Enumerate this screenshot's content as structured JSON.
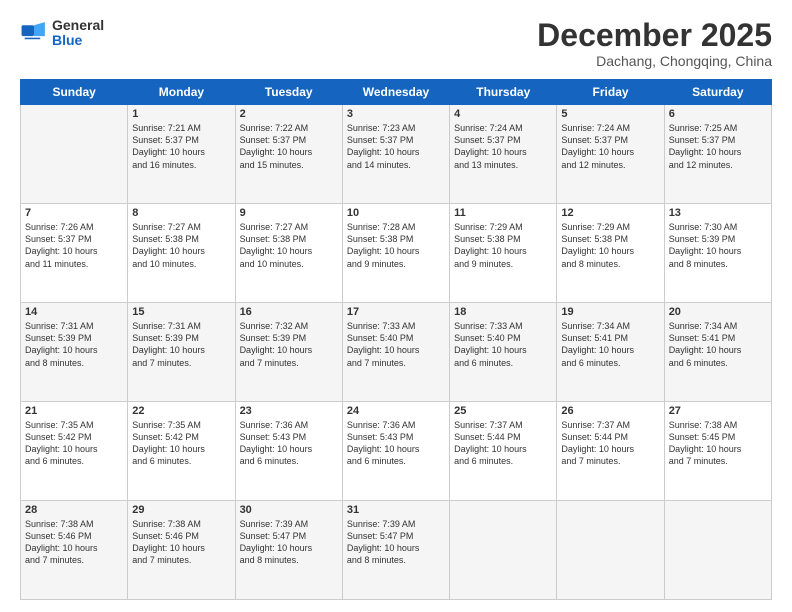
{
  "header": {
    "logo": {
      "general": "General",
      "blue": "Blue"
    },
    "title": "December 2025",
    "location": "Dachang, Chongqing, China"
  },
  "days_of_week": [
    "Sunday",
    "Monday",
    "Tuesday",
    "Wednesday",
    "Thursday",
    "Friday",
    "Saturday"
  ],
  "weeks": [
    [
      {
        "num": "",
        "info": "",
        "shade": true
      },
      {
        "num": "1",
        "info": "Sunrise: 7:21 AM\nSunset: 5:37 PM\nDaylight: 10 hours\nand 16 minutes.",
        "shade": true
      },
      {
        "num": "2",
        "info": "Sunrise: 7:22 AM\nSunset: 5:37 PM\nDaylight: 10 hours\nand 15 minutes.",
        "shade": true
      },
      {
        "num": "3",
        "info": "Sunrise: 7:23 AM\nSunset: 5:37 PM\nDaylight: 10 hours\nand 14 minutes.",
        "shade": true
      },
      {
        "num": "4",
        "info": "Sunrise: 7:24 AM\nSunset: 5:37 PM\nDaylight: 10 hours\nand 13 minutes.",
        "shade": true
      },
      {
        "num": "5",
        "info": "Sunrise: 7:24 AM\nSunset: 5:37 PM\nDaylight: 10 hours\nand 12 minutes.",
        "shade": true
      },
      {
        "num": "6",
        "info": "Sunrise: 7:25 AM\nSunset: 5:37 PM\nDaylight: 10 hours\nand 12 minutes.",
        "shade": true
      }
    ],
    [
      {
        "num": "7",
        "info": "Sunrise: 7:26 AM\nSunset: 5:37 PM\nDaylight: 10 hours\nand 11 minutes.",
        "shade": false
      },
      {
        "num": "8",
        "info": "Sunrise: 7:27 AM\nSunset: 5:38 PM\nDaylight: 10 hours\nand 10 minutes.",
        "shade": false
      },
      {
        "num": "9",
        "info": "Sunrise: 7:27 AM\nSunset: 5:38 PM\nDaylight: 10 hours\nand 10 minutes.",
        "shade": false
      },
      {
        "num": "10",
        "info": "Sunrise: 7:28 AM\nSunset: 5:38 PM\nDaylight: 10 hours\nand 9 minutes.",
        "shade": false
      },
      {
        "num": "11",
        "info": "Sunrise: 7:29 AM\nSunset: 5:38 PM\nDaylight: 10 hours\nand 9 minutes.",
        "shade": false
      },
      {
        "num": "12",
        "info": "Sunrise: 7:29 AM\nSunset: 5:38 PM\nDaylight: 10 hours\nand 8 minutes.",
        "shade": false
      },
      {
        "num": "13",
        "info": "Sunrise: 7:30 AM\nSunset: 5:39 PM\nDaylight: 10 hours\nand 8 minutes.",
        "shade": false
      }
    ],
    [
      {
        "num": "14",
        "info": "Sunrise: 7:31 AM\nSunset: 5:39 PM\nDaylight: 10 hours\nand 8 minutes.",
        "shade": true
      },
      {
        "num": "15",
        "info": "Sunrise: 7:31 AM\nSunset: 5:39 PM\nDaylight: 10 hours\nand 7 minutes.",
        "shade": true
      },
      {
        "num": "16",
        "info": "Sunrise: 7:32 AM\nSunset: 5:39 PM\nDaylight: 10 hours\nand 7 minutes.",
        "shade": true
      },
      {
        "num": "17",
        "info": "Sunrise: 7:33 AM\nSunset: 5:40 PM\nDaylight: 10 hours\nand 7 minutes.",
        "shade": true
      },
      {
        "num": "18",
        "info": "Sunrise: 7:33 AM\nSunset: 5:40 PM\nDaylight: 10 hours\nand 6 minutes.",
        "shade": true
      },
      {
        "num": "19",
        "info": "Sunrise: 7:34 AM\nSunset: 5:41 PM\nDaylight: 10 hours\nand 6 minutes.",
        "shade": true
      },
      {
        "num": "20",
        "info": "Sunrise: 7:34 AM\nSunset: 5:41 PM\nDaylight: 10 hours\nand 6 minutes.",
        "shade": true
      }
    ],
    [
      {
        "num": "21",
        "info": "Sunrise: 7:35 AM\nSunset: 5:42 PM\nDaylight: 10 hours\nand 6 minutes.",
        "shade": false
      },
      {
        "num": "22",
        "info": "Sunrise: 7:35 AM\nSunset: 5:42 PM\nDaylight: 10 hours\nand 6 minutes.",
        "shade": false
      },
      {
        "num": "23",
        "info": "Sunrise: 7:36 AM\nSunset: 5:43 PM\nDaylight: 10 hours\nand 6 minutes.",
        "shade": false
      },
      {
        "num": "24",
        "info": "Sunrise: 7:36 AM\nSunset: 5:43 PM\nDaylight: 10 hours\nand 6 minutes.",
        "shade": false
      },
      {
        "num": "25",
        "info": "Sunrise: 7:37 AM\nSunset: 5:44 PM\nDaylight: 10 hours\nand 6 minutes.",
        "shade": false
      },
      {
        "num": "26",
        "info": "Sunrise: 7:37 AM\nSunset: 5:44 PM\nDaylight: 10 hours\nand 7 minutes.",
        "shade": false
      },
      {
        "num": "27",
        "info": "Sunrise: 7:38 AM\nSunset: 5:45 PM\nDaylight: 10 hours\nand 7 minutes.",
        "shade": false
      }
    ],
    [
      {
        "num": "28",
        "info": "Sunrise: 7:38 AM\nSunset: 5:46 PM\nDaylight: 10 hours\nand 7 minutes.",
        "shade": true
      },
      {
        "num": "29",
        "info": "Sunrise: 7:38 AM\nSunset: 5:46 PM\nDaylight: 10 hours\nand 7 minutes.",
        "shade": true
      },
      {
        "num": "30",
        "info": "Sunrise: 7:39 AM\nSunset: 5:47 PM\nDaylight: 10 hours\nand 8 minutes.",
        "shade": true
      },
      {
        "num": "31",
        "info": "Sunrise: 7:39 AM\nSunset: 5:47 PM\nDaylight: 10 hours\nand 8 minutes.",
        "shade": true
      },
      {
        "num": "",
        "info": "",
        "shade": true
      },
      {
        "num": "",
        "info": "",
        "shade": true
      },
      {
        "num": "",
        "info": "",
        "shade": true
      }
    ]
  ]
}
